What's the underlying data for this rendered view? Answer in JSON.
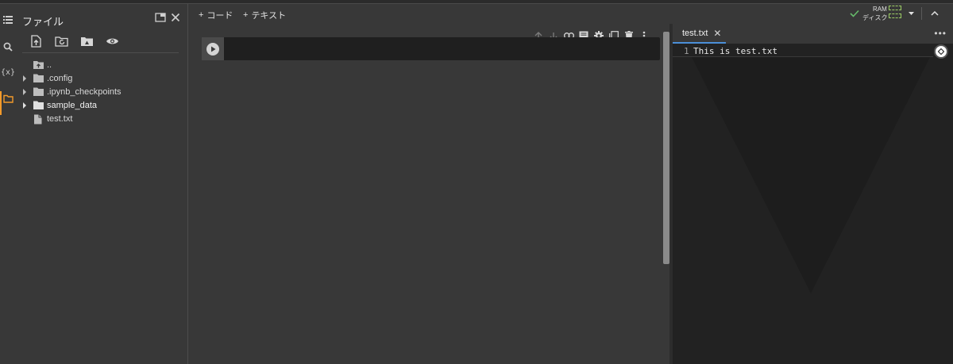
{
  "files_panel": {
    "title": "ファイル",
    "tree": [
      {
        "label": "..",
        "kind": "parent",
        "caret": false
      },
      {
        "label": ".config",
        "kind": "folder",
        "caret": true
      },
      {
        "label": ".ipynb_checkpoints",
        "kind": "folder",
        "caret": true
      },
      {
        "label": "sample_data",
        "kind": "folder",
        "caret": true
      },
      {
        "label": "test.txt",
        "kind": "file",
        "caret": false
      }
    ]
  },
  "notebook": {
    "add_code_label": "コード",
    "add_text_label": "テキスト",
    "add_symbol": "+"
  },
  "status": {
    "ram_label": "RAM",
    "disk_label": "ディスク",
    "connected_color": "#66bb6a"
  },
  "editor": {
    "tab_label": "test.txt",
    "tab_close": "✕",
    "more_label": "•••",
    "lines": [
      {
        "num": "1",
        "text": "This is test.txt"
      }
    ]
  },
  "icons": {
    "activity": [
      "toc-icon",
      "search-icon",
      "variables-icon",
      "folder-icon"
    ],
    "variables_text": "{x}"
  }
}
